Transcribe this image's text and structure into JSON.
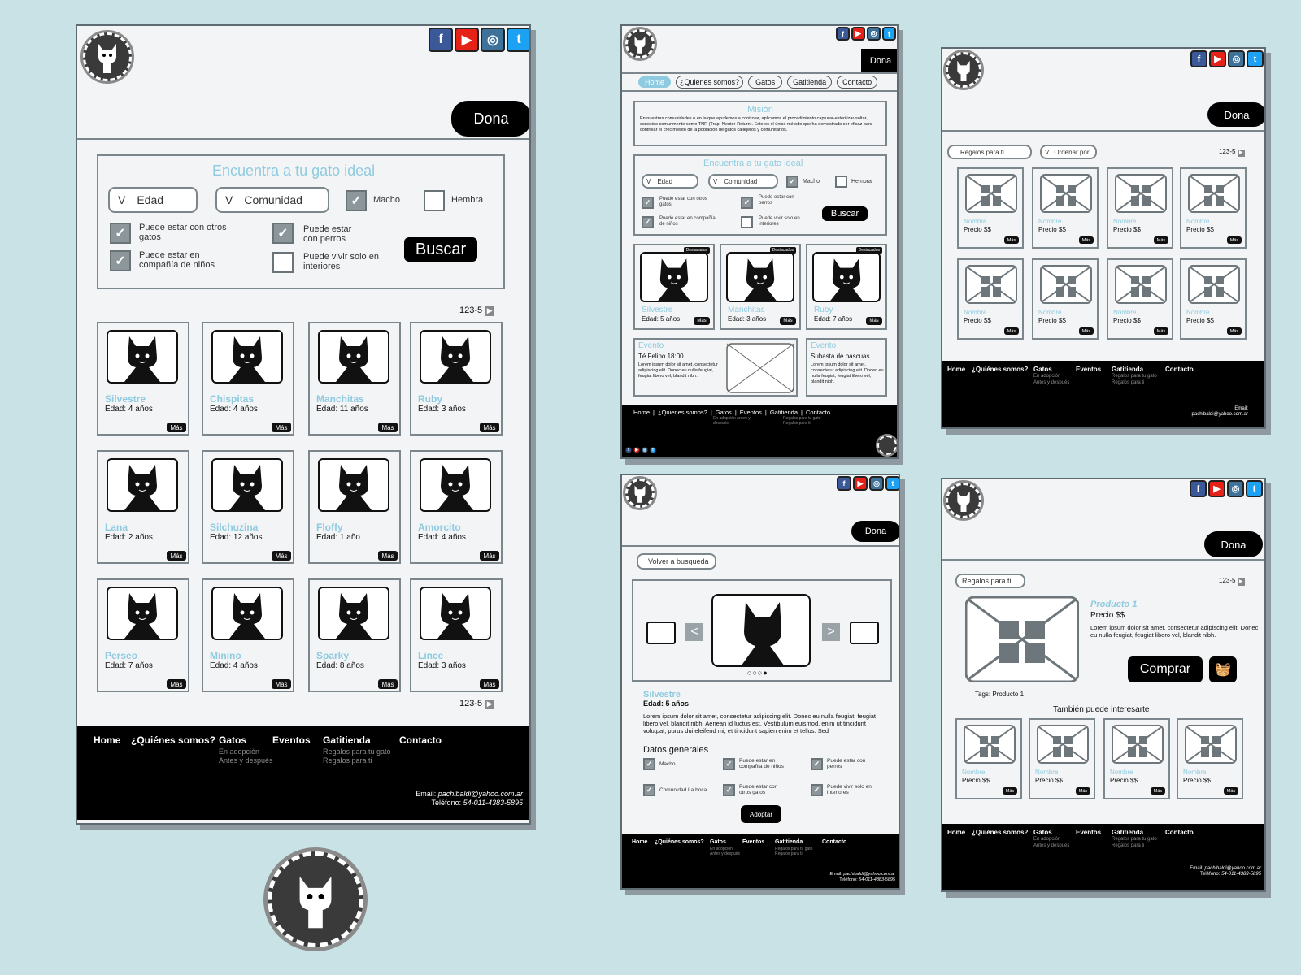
{
  "brand": {
    "facebook": "f",
    "youtube": "▶",
    "instagram": "◎",
    "twitter": "t",
    "colors": {
      "accent": "#8fcbe0",
      "dark": "#000000",
      "border": "#7c878d"
    }
  },
  "main": {
    "dona": "Dona",
    "search_title": "Encuentra a tu gato ideal",
    "edad": "Edad",
    "comunidad": "Comunidad",
    "macho": "Macho",
    "hembra": "Hembra",
    "opt1": "Puede estar con otros gatos",
    "opt2": "Puede estar en compañía de niños",
    "opt3": "Puede estar con perros",
    "opt4": "Puede vivir solo en interiores",
    "buscar": "Buscar",
    "pagination": "123-5",
    "mas": "Más",
    "cats": [
      {
        "name": "Silvestre",
        "age": "Edad: 4 años"
      },
      {
        "name": "Chispitas",
        "age": "Edad: 4 años"
      },
      {
        "name": "Manchitas",
        "age": "Edad: 11 años"
      },
      {
        "name": "Ruby",
        "age": "Edad: 3 años"
      },
      {
        "name": "Lana",
        "age": "Edad: 2 años"
      },
      {
        "name": "Silchuzina",
        "age": "Edad: 12 años"
      },
      {
        "name": "Floffy",
        "age": "Edad: 1 año"
      },
      {
        "name": "Amorcito",
        "age": "Edad: 4 años"
      },
      {
        "name": "Perseo",
        "age": "Edad: 7 años"
      },
      {
        "name": "Minino",
        "age": "Edad: 4 años"
      },
      {
        "name": "Sparky",
        "age": "Edad: 8 años"
      },
      {
        "name": "Lince",
        "age": "Edad: 3 años"
      }
    ]
  },
  "footer": {
    "home": "Home",
    "quienes": "¿Quiénes somos?",
    "gatos": "Gatos",
    "eventos": "Eventos",
    "gatitienda": "Gatitienda",
    "contacto": "Contacto",
    "gatos_sub1": "En adopción",
    "gatos_sub2": "Antes y después",
    "tienda_sub1": "Regalos para tu gato",
    "tienda_sub2": "Regalos para ti",
    "email_label": "Email:",
    "email": "pachibaldi@yahoo.com.ar",
    "tel_label": "Teléfono:",
    "tel": "54-011-4383-5895"
  },
  "home": {
    "dona": "Dona",
    "nav": [
      "Home",
      "¿Quienes somos?",
      "Gatos",
      "Gatitienda",
      "Contacto"
    ],
    "mision_title": "Misión",
    "mision_text": "En nuestras comunidades o en la que ayudemos a controlar, aplicamos el procedimiento capturar-esterilizar-soltar, conocido comunmente como TNR (Trap- Neuter-Return). Este es el único método que ha demostrado ser eficaz para controlar el crecimiento de la población de gatos callejeros y comunitarios.",
    "search_title": "Encuentra a tu gato ideal",
    "edad": "Edad",
    "comunidad": "Comunidad",
    "macho": "Macho",
    "hembra": "Hembra",
    "opt1": "Puede estar con otros gatos",
    "opt2": "Puede estar en compañía de niños",
    "opt3": "Puede estar con perros",
    "opt4": "Puede vivir solo en interiores",
    "buscar": "Buscar",
    "badge": "Destacados",
    "mas": "Más",
    "featured": [
      {
        "name": "Silvestre",
        "age": "Edad: 5 años"
      },
      {
        "name": "Manchitas",
        "age": "Edad: 3 años"
      },
      {
        "name": "Ruby",
        "age": "Edad: 7 años"
      }
    ],
    "event1_title": "Evento",
    "event1_sub": "Té Felino 18:00",
    "event1_text": "Lorem ipsum dolor sit amet, consectetur adipiscing elit. Donec eu nulla feugiat, feugiat libero vel, blandit nibh.",
    "event2_title": "Evento",
    "event2_sub": "Subasta de pascuas",
    "event2_text": "Lorem ipsum dolor sit amet, consectetur adipiscing elit. Donec eu nulla feugiat, feugiat libero vel, blandit nibh.",
    "footer_nav": [
      "Home",
      "¿Quienes somos?",
      "Gatos",
      "Eventos",
      "Gatitienda",
      "Contacto"
    ],
    "footer_gatos_sub": "En adopción Antes y después",
    "footer_tienda_sub": "Regalos para tu gato Regalos para ti"
  },
  "shop": {
    "dona": "Dona",
    "filter1": "Regalos para ti",
    "filter2": "Ordenar por",
    "pagination": "123-5",
    "item_name": "Nombre",
    "item_price": "Precio $$",
    "mas": "Más"
  },
  "detail": {
    "dona": "Dona",
    "back": "Volver a busqueda",
    "name": "Silvestre",
    "age": "Edad: 5 años",
    "text": "Lorem ipsum dolor sit amet, consectetur adipiscing elit. Donec eu nulla feugiat, feugiat libero vel, blandit nibh. Aenean id luctus est. Vestibulum euismod, enim ut tincidunt volutpat, purus dui eleifend mi, et tincidunt sapien enim et tellus. Sed",
    "datos": "Datos generales",
    "d1": "Macho",
    "d2": "Puede estar en compañía de niños",
    "d3": "Puede estar con perros",
    "d4": "Comunidad La boca",
    "d5": "Puede estar con otros gatos",
    "d6": "Puede vivir solo en interiores",
    "adoptar": "Adoptar",
    "dots": "○○○●"
  },
  "product": {
    "dona": "Dona",
    "filter": "Regalos para ti",
    "pagination": "123-5",
    "title": "Producto 1",
    "price": "Precio $$",
    "text": "Lorem ipsum dolor sit amet, consectetur adipiscing elit. Donec eu nulla feugiat, feugiat libero vel, blandit nibh.",
    "comprar": "Comprar",
    "tags": "Tags: Producto 1",
    "related": "También puede interesarte",
    "item_name": "Nombre",
    "item_price": "Precio $$",
    "mas": "Más"
  }
}
